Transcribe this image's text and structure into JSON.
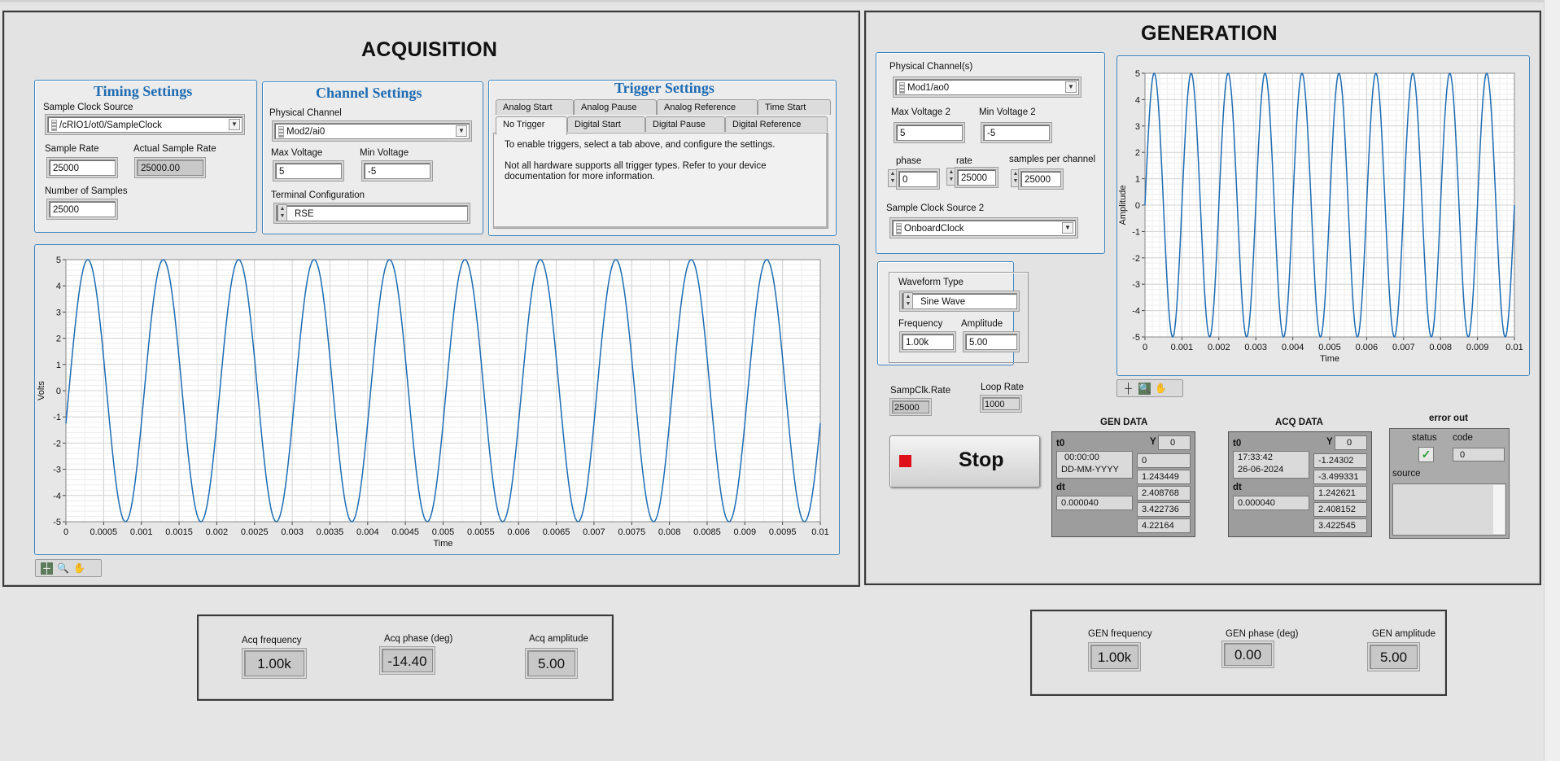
{
  "acquisition": {
    "title": "ACQUISITION",
    "timing": {
      "title": "Timing Settings",
      "sample_clock_source_label": "Sample Clock Source",
      "sample_clock_source": "/cRIO1/ot0/SampleClock",
      "sample_rate_label": "Sample Rate",
      "sample_rate": "25000",
      "actual_rate_label": "Actual Sample Rate",
      "actual_rate": "25000.00",
      "num_samples_label": "Number of Samples",
      "num_samples": "25000"
    },
    "channel": {
      "title": "Channel Settings",
      "physical_channel_label": "Physical Channel",
      "physical_channel": "Mod2/ai0",
      "max_voltage_label": "Max Voltage",
      "max_voltage": "5",
      "min_voltage_label": "Min Voltage",
      "min_voltage": "-5",
      "terminal_config_label": "Terminal Configuration",
      "terminal_config": "RSE"
    },
    "trigger": {
      "title": "Trigger Settings",
      "tabs_row1": [
        "Analog Start",
        "Analog Pause",
        "Analog Reference",
        "Time Start"
      ],
      "tabs_row2": [
        "No Trigger",
        "Digital Start",
        "Digital Pause",
        "Digital Reference"
      ],
      "active_tab": "No Trigger",
      "text1": "To enable triggers, select a tab above, and configure the settings.",
      "text2a": "Not all hardware supports all trigger types. Refer to your device",
      "text2b": "documentation for more information."
    },
    "graph_palette_icons": [
      "crosshair-icon",
      "zoom-icon",
      "hand-icon"
    ]
  },
  "generation": {
    "title": "GENERATION",
    "physical_channels_label": "Physical Channel(s)",
    "physical_channels": "Mod1/ao0",
    "max_voltage2_label": "Max Voltage 2",
    "max_voltage2": "5",
    "min_voltage2_label": "Min Voltage 2",
    "min_voltage2": "-5",
    "phase_label": "phase",
    "phase": "0",
    "rate_label": "rate",
    "rate": "25000",
    "spc_label": "samples per channel",
    "spc": "25000",
    "sample_clock2_label": "Sample Clock Source 2",
    "sample_clock2": "OnboardClock",
    "waveform_type_label": "Waveform Type",
    "waveform_type": "Sine Wave",
    "frequency_label": "Frequency",
    "frequency": "1.00k",
    "amplitude_label": "Amplitude",
    "amplitude": "5.00",
    "sampclk_rate_label": "SampClk.Rate",
    "sampclk_rate": "25000",
    "loop_rate_label": "Loop Rate",
    "loop_rate": "1000",
    "stop_label": "Stop"
  },
  "gen_data": {
    "title": "GEN DATA",
    "t0_label": "t0",
    "t0_line1": "00:00:00",
    "t0_line2": "DD-MM-YYYY",
    "dt_label": "dt",
    "dt": "0.000040",
    "y_label": "Y",
    "y_index": "0",
    "y_values": [
      "0",
      "1.243449",
      "2.408768",
      "3.422736",
      "4.22164"
    ]
  },
  "acq_data": {
    "title": "ACQ DATA",
    "t0_label": "t0",
    "t0_line1": "17:33:42",
    "t0_line2": "26-06-2024",
    "dt_label": "dt",
    "dt": "0.000040",
    "y_label": "Y",
    "y_index": "0",
    "y_values": [
      "-1.24302",
      "-3.499331",
      "1.242621",
      "2.408152",
      "3.422545"
    ]
  },
  "error_out": {
    "title": "error out",
    "status_label": "status",
    "code_label": "code",
    "code": "0",
    "source_label": "source",
    "status_color": "#2e9e2e"
  },
  "acq_results": {
    "freq_label": "Acq frequency",
    "freq": "1.00k",
    "phase_label": "Acq phase (deg)",
    "phase": "-14.40",
    "amp_label": "Acq amplitude",
    "amp": "5.00"
  },
  "gen_results": {
    "freq_label": "GEN frequency",
    "freq": "1.00k",
    "phase_label": "GEN phase (deg)",
    "phase": "0.00",
    "amp_label": "GEN amplitude",
    "amp": "5.00"
  },
  "chart_data": [
    {
      "type": "line",
      "name": "acquisition-graph",
      "xlabel": "Time",
      "ylabel": "Volts",
      "xlim": [
        0,
        0.01
      ],
      "ylim": [
        -5,
        5
      ],
      "x_ticks": [
        "0",
        "0.0005",
        "0.001",
        "0.0015",
        "0.002",
        "0.0025",
        "0.003",
        "0.0035",
        "0.004",
        "0.0045",
        "0.005",
        "0.0055",
        "0.006",
        "0.0065",
        "0.007",
        "0.0075",
        "0.008",
        "0.0085",
        "0.009",
        "0.0095",
        "0.01"
      ],
      "y_ticks": [
        "5",
        "4",
        "3",
        "2",
        "1",
        "0",
        "-1",
        "-2",
        "-3",
        "-4",
        "-5"
      ],
      "grid": true,
      "series": [
        {
          "frequency_hz": 1000,
          "amplitude": 5,
          "phase_deg": -14.4,
          "color": "#1f6cb3"
        }
      ]
    },
    {
      "type": "line",
      "name": "generation-graph",
      "xlabel": "Time",
      "ylabel": "Amplitude",
      "xlim": [
        0,
        0.01
      ],
      "ylim": [
        -5,
        5
      ],
      "x_ticks": [
        "0",
        "0.001",
        "0.002",
        "0.003",
        "0.004",
        "0.005",
        "0.006",
        "0.007",
        "0.008",
        "0.009",
        "0.01"
      ],
      "y_ticks": [
        "5",
        "4",
        "3",
        "2",
        "1",
        "0",
        "-1",
        "-2",
        "-3",
        "-4",
        "-5"
      ],
      "grid": true,
      "series": [
        {
          "frequency_hz": 1000,
          "amplitude": 5,
          "phase_deg": 0,
          "color": "#1f6cb3"
        }
      ]
    }
  ]
}
